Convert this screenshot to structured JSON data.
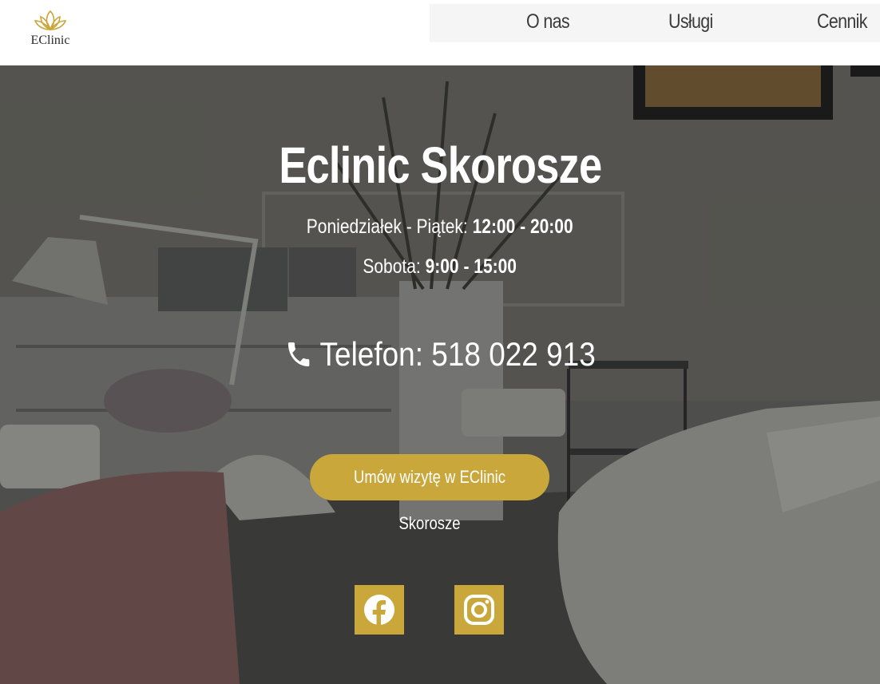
{
  "brand": {
    "logo_text": "EClinic",
    "accent_color": "#c9a73b",
    "logo_icon": "lotus-icon"
  },
  "nav": {
    "items": [
      {
        "label": "O nas"
      },
      {
        "label": "Usługi"
      },
      {
        "label": "Cennik"
      }
    ]
  },
  "hero": {
    "title": "Eclinic Skorosze",
    "hours": {
      "weekday_label": "Poniedziałek - Piątek:",
      "weekday_time": "12:00 - 20:00",
      "saturday_label": "Sobota:",
      "saturday_time": "9:00 - 15:00"
    },
    "phone": {
      "icon": "phone-icon",
      "text": "Telefon: 518 022 913"
    },
    "cta_label": "Umów wizytę w EClinic Skorosze",
    "social": [
      {
        "name": "facebook",
        "icon": "facebook-icon"
      },
      {
        "name": "instagram",
        "icon": "instagram-icon"
      }
    ]
  }
}
